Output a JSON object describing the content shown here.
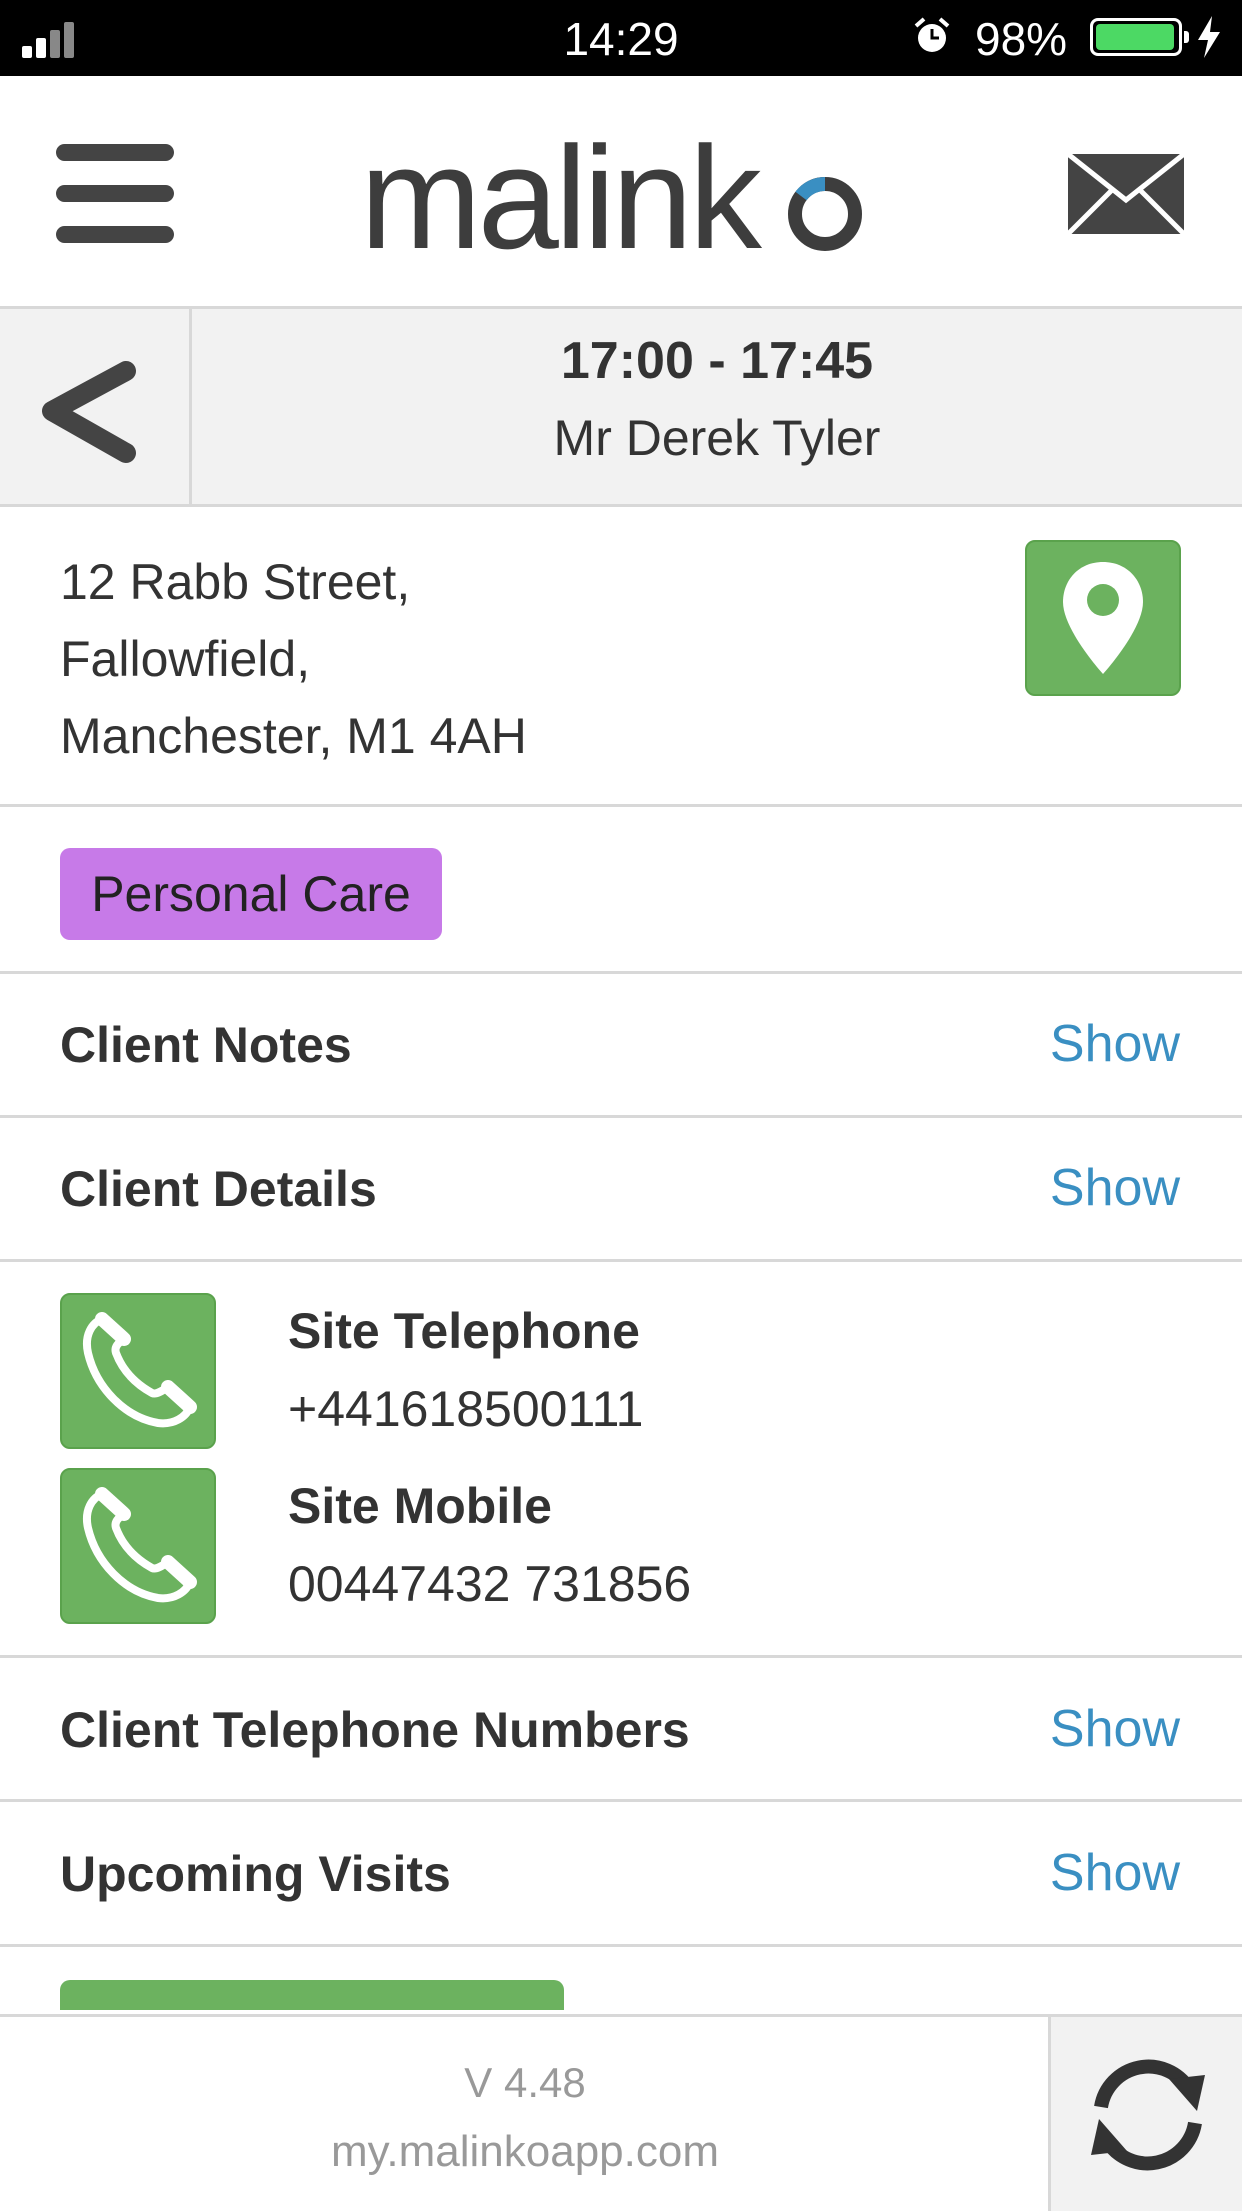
{
  "status_bar": {
    "time": "14:29",
    "battery_percent": "98%",
    "battery_level": 0.98,
    "icons": [
      "signal-icon",
      "alarm-icon",
      "battery-icon",
      "charging-bolt-icon"
    ]
  },
  "header": {
    "logo": "malinko",
    "icons": [
      "hamburger-menu-icon",
      "mail-icon"
    ]
  },
  "visit": {
    "time_range": "17:00 - 17:45",
    "client_name": "Mr Derek Tyler",
    "back_icon": "chevron-left-icon"
  },
  "address": {
    "line1": "12 Rabb Street,",
    "line2": "Fallowfield,",
    "line3": "Manchester, M1 4AH",
    "map_icon": "map-pin-icon"
  },
  "tag": {
    "label": "Personal Care",
    "color": "#c77ae8"
  },
  "sections": [
    {
      "title": "Client Notes",
      "action": "Show"
    },
    {
      "title": "Client Details",
      "action": "Show"
    },
    {
      "title": "Client Telephone Numbers",
      "action": "Show"
    },
    {
      "title": "Upcoming Visits",
      "action": "Show"
    }
  ],
  "phones": [
    {
      "label": "Site Telephone",
      "number": "+441618500111",
      "icon": "phone-icon"
    },
    {
      "label": "Site Mobile",
      "number": "00447432 731856",
      "icon": "phone-icon"
    }
  ],
  "footer": {
    "version": "V 4.48",
    "url": "my.malinkoapp.com",
    "sync_icon": "sync-icon"
  },
  "colors": {
    "accent_green": "#6cb25f",
    "link_blue": "#3a8fc2",
    "tag_purple": "#c77ae8"
  }
}
